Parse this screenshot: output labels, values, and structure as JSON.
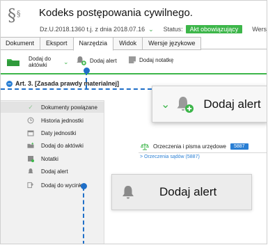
{
  "header": {
    "logo": "§",
    "logo_sup": "§",
    "title": "Kodeks postępowania cywilnego.",
    "dz": "Dz.U.2018.1360 t.j. z dnia 2018.07.16",
    "status_label": "Status:",
    "status_value": "Akt obowiązujący",
    "extra": "Wersja"
  },
  "tabs": [
    "Dokument",
    "Eksport",
    "Narzędzia",
    "Widok",
    "Wersje językowe"
  ],
  "active_tab": "Narzędzia",
  "toolbar": {
    "aktowki_label_line1": "Dodaj do",
    "aktowki_label_line2": "aktówki",
    "alert_label": "Dodaj alert",
    "note_label": "Dodaj notatkę"
  },
  "article": {
    "title": "Art. 3. [Zasada prawdy materialnej]"
  },
  "menu": {
    "items": [
      {
        "label": "Dokumenty powiązane",
        "icon": "check-icon"
      },
      {
        "label": "Historia jednostki",
        "icon": "clock-icon"
      },
      {
        "label": "Daty jednostki",
        "icon": "calendar-icon"
      },
      {
        "label": "Dodaj do aktówki",
        "icon": "folder-add-icon"
      },
      {
        "label": "Notatki",
        "icon": "note-icon"
      },
      {
        "label": "Dodaj alert",
        "icon": "bell-icon"
      },
      {
        "label": "Dodaj do wycinka",
        "icon": "clip-icon"
      }
    ]
  },
  "content": {
    "orzeczenia_label": "Orzeczenia i pisma urzędowe",
    "orzeczenia_count": "5887",
    "sady_link": "> Orzeczenia sądów (5887)"
  },
  "callouts": {
    "top": "Dodaj alert",
    "bottom": "Dodaj alert"
  },
  "colors": {
    "accent_green": "#3db64a",
    "accent_blue": "#2a7fd4"
  }
}
